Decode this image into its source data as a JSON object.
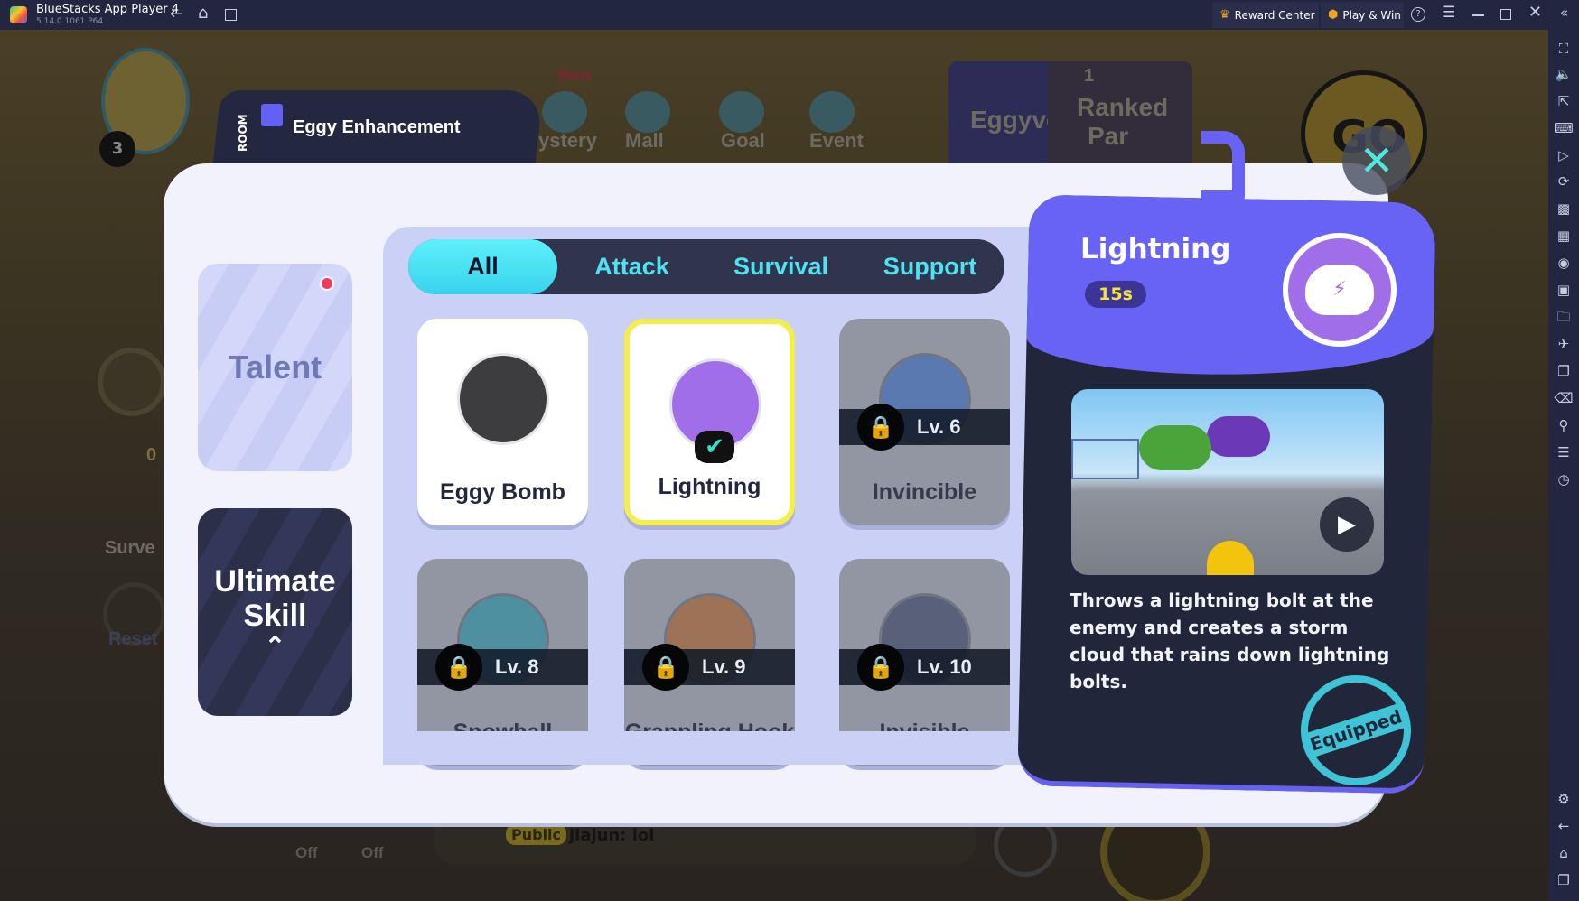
{
  "titlebar": {
    "app_name": "BlueStacks App Player 4",
    "version": "5.14.0.1061 P64",
    "reward_center": "Reward Center",
    "play_win": "Play & Win"
  },
  "background": {
    "level": "3",
    "top_icons": [
      {
        "label": "New"
      },
      {
        "label": "ystery"
      },
      {
        "label": "Mall"
      },
      {
        "label": "Goal"
      },
      {
        "label": "Event"
      }
    ],
    "eggyverse": "Eggyverse",
    "ranked_count": "1",
    "ranked": "Ranked",
    "party": "Par",
    "go": "GO",
    "left_count": "0",
    "survey": "Surve",
    "reset": "Reset",
    "off1": "Off",
    "off2": "Off",
    "chat_channel": "Public",
    "chat_message": "jiajun: lol"
  },
  "header": {
    "logo_text": "ROOM",
    "title": "Eggy Enhancement"
  },
  "side": {
    "talent": "Talent",
    "ultimate_line1": "Ultimate",
    "ultimate_line2": "Skill"
  },
  "tabs": [
    {
      "label": "All",
      "active": true
    },
    {
      "label": "Attack"
    },
    {
      "label": "Survival"
    },
    {
      "label": "Support"
    }
  ],
  "skills": [
    {
      "name": "Eggy Bomb",
      "locked": false,
      "color": "#3d3d3f"
    },
    {
      "name": "Lightning",
      "locked": false,
      "selected": true,
      "equipped": true,
      "color": "#a06ee9"
    },
    {
      "name": "Invincible",
      "locked": true,
      "level": "Lv. 6",
      "color": "#4d72b4"
    },
    {
      "name": "Snowball",
      "locked": true,
      "level": "Lv. 8",
      "color": "#3f8fa0"
    },
    {
      "name": "Grappling Hook",
      "locked": true,
      "level": "Lv. 9",
      "color": "#a06a45"
    },
    {
      "name": "Invisible",
      "locked": true,
      "level": "Lv. 10",
      "color": "#4a5371"
    }
  ],
  "detail": {
    "title": "Lightning",
    "cooldown": "15s",
    "description": "Throws a lightning bolt at the enemy and creates a storm cloud that rains down lightning bolts.",
    "stamp": "Equipped"
  },
  "colors": {
    "accent_purple": "#6862f5",
    "cyan": "#4fe2f3",
    "panel_dark": "#22263b",
    "selected_border": "#f5ee4a"
  }
}
